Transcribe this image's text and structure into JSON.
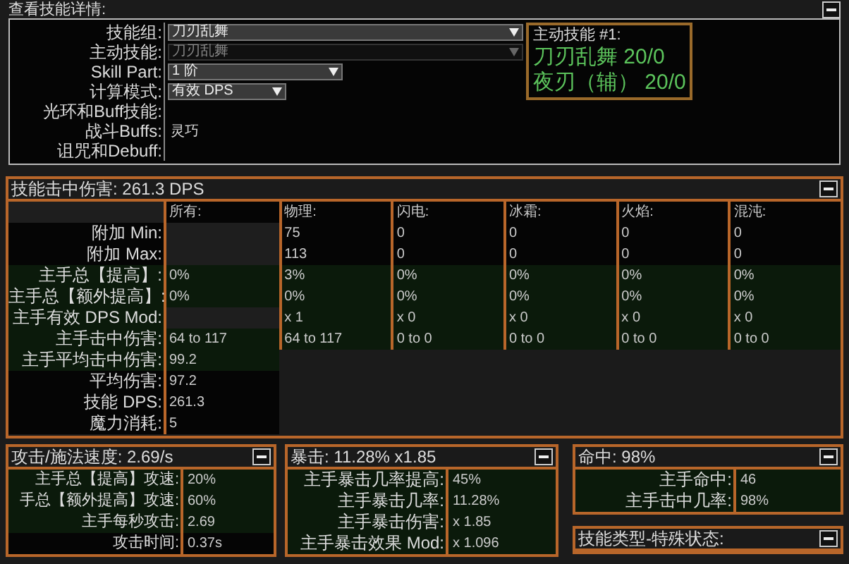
{
  "title": "查看技能详情:",
  "skill_details": {
    "rows": [
      {
        "label": "技能组:",
        "kind": "dropdown",
        "value": "刀刃乱舞",
        "disabled": false
      },
      {
        "label": "主动技能:",
        "kind": "dropdown",
        "value": "刀刃乱舞",
        "disabled": true
      },
      {
        "label": "Skill Part:",
        "kind": "dropdown",
        "value": "1 阶",
        "disabled": false
      },
      {
        "label": "计算模式:",
        "kind": "dropdown",
        "value": "有效 DPS",
        "disabled": false
      },
      {
        "label": "光环和Buff技能:",
        "kind": "text"
      },
      {
        "label": "战斗Buffs:",
        "kind": "text",
        "value": "灵巧"
      },
      {
        "label": "诅咒和Debuff:",
        "kind": "text"
      }
    ],
    "active_skill": {
      "heading": "主动技能 #1:",
      "lines": [
        "刀刃乱舞 20/0",
        "夜刃（辅） 20/0"
      ]
    }
  },
  "damage": {
    "title": "技能击中伤害: 261.3 DPS",
    "columns": [
      "所有:",
      "物理:",
      "闪电:",
      "冰霜:",
      "火焰:",
      "混沌:"
    ],
    "rows": [
      {
        "label": "附加 Min:",
        "highlighted": false,
        "cells": [
          null,
          "75",
          "0",
          "0",
          "0",
          "0"
        ]
      },
      {
        "label": "附加 Max:",
        "highlighted": false,
        "cells": [
          null,
          "113",
          "0",
          "0",
          "0",
          "0"
        ]
      },
      {
        "label": "主手总【提高】:",
        "highlighted": true,
        "cells": [
          "0%",
          "3%",
          "0%",
          "0%",
          "0%",
          "0%"
        ]
      },
      {
        "label": "主手总【额外提高】:",
        "highlighted": true,
        "cells": [
          "0%",
          "0%",
          "0%",
          "0%",
          "0%",
          "0%"
        ]
      },
      {
        "label": "主手有效 DPS Mod:",
        "highlighted": true,
        "cells": [
          null,
          "x 1",
          "x 0",
          "x 0",
          "x 0",
          "x 0"
        ]
      },
      {
        "label": "主手击中伤害:",
        "highlighted": true,
        "cells": [
          "64 to 117",
          "64 to 117",
          "0 to 0",
          "0 to 0",
          "0 to 0",
          "0 to 0"
        ]
      },
      {
        "label": "主手平均击中伤害:",
        "highlighted": true,
        "cells": [
          "99.2"
        ]
      },
      {
        "label": "平均伤害:",
        "highlighted": false,
        "cells": [
          "97.2"
        ]
      },
      {
        "label": "技能 DPS:",
        "highlighted": false,
        "cells": [
          "261.3"
        ]
      },
      {
        "label": "魔力消耗:",
        "highlighted": false,
        "cells": [
          "5"
        ]
      }
    ]
  },
  "panels": [
    {
      "title": "攻击/施法速度: 2.69/s",
      "rows": [
        {
          "label": "主手总【提高】攻速:",
          "value": "20%",
          "highlighted": true
        },
        {
          "label": "手总【额外提高】攻速:",
          "value": "60%",
          "highlighted": true
        },
        {
          "label": "主手每秒攻击:",
          "value": "2.69",
          "highlighted": true
        },
        {
          "label": "攻击时间:",
          "value": "0.37s",
          "highlighted": false
        }
      ]
    },
    {
      "title": "暴击: 11.28% x1.85",
      "rows": [
        {
          "label": "主手暴击几率提高:",
          "value": "45%",
          "highlighted": true
        },
        {
          "label": "主手暴击几率:",
          "value": "11.28%",
          "highlighted": true
        },
        {
          "label": "主手暴击伤害:",
          "value": "x 1.85",
          "highlighted": true
        },
        {
          "label": "主手暴击效果 Mod:",
          "value": "x 1.096",
          "highlighted": true
        }
      ]
    },
    {
      "title": "命中: 98%",
      "rows": [
        {
          "label": "主手命中:",
          "value": "46",
          "highlighted": true
        },
        {
          "label": "主手击中几率:",
          "value": "98%",
          "highlighted": true
        }
      ]
    },
    {
      "title": "技能类型-特殊状态:"
    }
  ]
}
